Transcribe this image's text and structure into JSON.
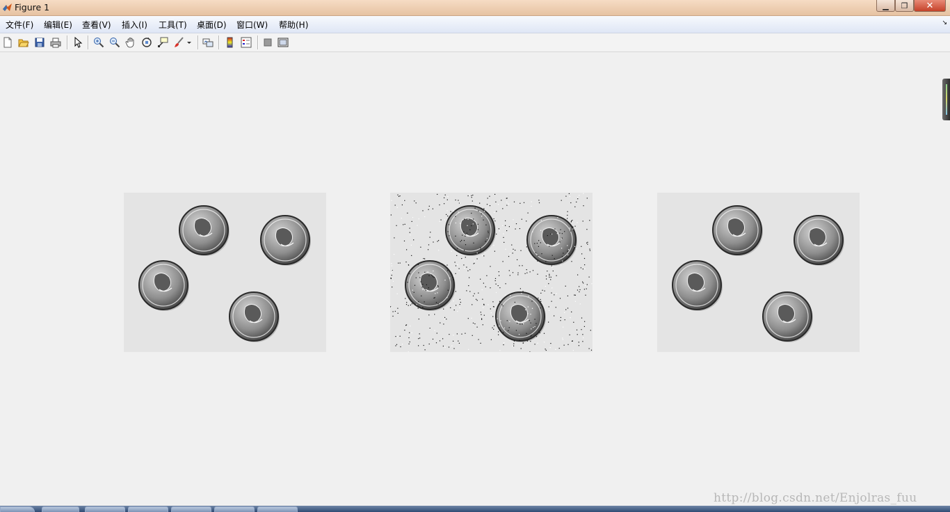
{
  "window": {
    "title": "Figure 1"
  },
  "window_buttons": {
    "minimize": "▁",
    "restore": "❐",
    "close": "✕"
  },
  "menu": {
    "items": [
      {
        "label": "文件(F)"
      },
      {
        "label": "编辑(E)"
      },
      {
        "label": "查看(V)"
      },
      {
        "label": "插入(I)"
      },
      {
        "label": "工具(T)"
      },
      {
        "label": "桌面(D)"
      },
      {
        "label": "窗口(W)"
      },
      {
        "label": "帮助(H)"
      }
    ],
    "overflow_arrow": "↘"
  },
  "toolbar": {
    "icons": [
      "new-figure-icon",
      "open-file-icon",
      "save-icon",
      "print-icon",
      "select-arrow-icon",
      "zoom-in-icon",
      "zoom-out-icon",
      "pan-hand-icon",
      "rotate-3d-icon",
      "data-cursor-icon",
      "brush-icon",
      "link-plot-icon",
      "colorbar-icon",
      "legend-icon",
      "hide-plot-tools-icon",
      "show-plot-tools-icon"
    ]
  },
  "figure": {
    "panels": [
      {
        "name": "original-coins-image",
        "noise": false
      },
      {
        "name": "noisy-coins-image",
        "noise": true
      },
      {
        "name": "filtered-coins-image",
        "noise": false
      }
    ]
  },
  "watermark": {
    "text": "http://blog.csdn.net/Enjolras_fuu"
  },
  "colors": {
    "titlebar": "#e6c2a2",
    "menubar": "#dfe6f5",
    "background": "#f0f0f0",
    "taskbar": "#2f4b74"
  }
}
